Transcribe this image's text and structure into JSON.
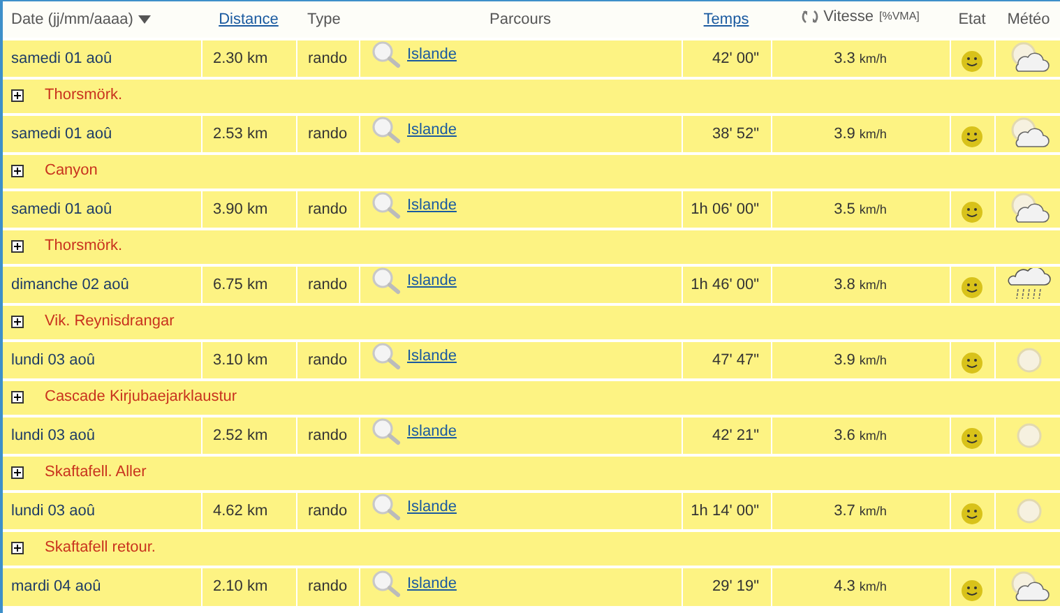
{
  "table": {
    "columns": [
      {
        "label": "Date (jj/mm/aaaa)",
        "kind": "plain",
        "sorted": true
      },
      {
        "label": "Distance",
        "kind": "link",
        "sorted": false
      },
      {
        "label": "Type",
        "kind": "plain",
        "sorted": false
      },
      {
        "label": "Parcours",
        "kind": "plain",
        "sorted": false
      },
      {
        "label": "Temps",
        "kind": "link",
        "sorted": false
      },
      {
        "label": "Vitesse",
        "note": "[%VMA]",
        "kind": "toggle",
        "sorted": false
      },
      {
        "label": "Etat",
        "kind": "plain",
        "sorted": false
      },
      {
        "label": "Météo",
        "kind": "plain",
        "sorted": false
      }
    ],
    "rows": [
      {
        "date": "samedi 01 aoû",
        "distance": "2.30 km",
        "type": "rando",
        "route": "Islande",
        "time": "42' 00\"",
        "speed": "3.3",
        "unit": "km/h",
        "etat": {
          "kind": "happy"
        },
        "meteo": {
          "kind": "sun_cloud"
        },
        "detail": "Thorsmörk.",
        "expanded": false
      },
      {
        "date": "samedi 01 aoû",
        "distance": "2.53 km",
        "type": "rando",
        "route": "Islande",
        "time": "38' 52\"",
        "speed": "3.9",
        "unit": "km/h",
        "etat": {
          "kind": "happy"
        },
        "meteo": {
          "kind": "sun_cloud"
        },
        "detail": "Canyon",
        "expanded": false
      },
      {
        "date": "samedi 01 aoû",
        "distance": "3.90 km",
        "type": "rando",
        "route": "Islande",
        "time": "1h 06' 00\"",
        "speed": "3.5",
        "unit": "km/h",
        "etat": {
          "kind": "happy"
        },
        "meteo": {
          "kind": "sun_cloud"
        },
        "detail": "Thorsmörk.",
        "expanded": false
      },
      {
        "date": "dimanche 02 aoû",
        "distance": "6.75 km",
        "type": "rando",
        "route": "Islande",
        "time": "1h 46' 00\"",
        "speed": "3.8",
        "unit": "km/h",
        "etat": {
          "kind": "happy"
        },
        "meteo": {
          "kind": "rain"
        },
        "detail": "Vik. Reynisdrangar",
        "expanded": false
      },
      {
        "date": "lundi 03 aoû",
        "distance": "3.10 km",
        "type": "rando",
        "route": "Islande",
        "time": "47' 47\"",
        "speed": "3.9",
        "unit": "km/h",
        "etat": {
          "kind": "happy"
        },
        "meteo": {
          "kind": "sun"
        },
        "detail": "Cascade Kirjubaejarklaustur",
        "expanded": false
      },
      {
        "date": "lundi 03 aoû",
        "distance": "2.52 km",
        "type": "rando",
        "route": "Islande",
        "time": "42' 21\"",
        "speed": "3.6",
        "unit": "km/h",
        "etat": {
          "kind": "happy"
        },
        "meteo": {
          "kind": "sun"
        },
        "detail": "Skaftafell. Aller",
        "expanded": false
      },
      {
        "date": "lundi 03 aoû",
        "distance": "4.62 km",
        "type": "rando",
        "route": "Islande",
        "time": "1h 14' 00\"",
        "speed": "3.7",
        "unit": "km/h",
        "etat": {
          "kind": "happy"
        },
        "meteo": {
          "kind": "sun"
        },
        "detail": "Skaftafell retour.",
        "expanded": false
      },
      {
        "date": "mardi 04 aoû",
        "distance": "2.10 km",
        "type": "rando",
        "route": "Islande",
        "time": "29' 19\"",
        "speed": "4.3",
        "unit": "km/h",
        "etat": {
          "kind": "happy"
        },
        "meteo": {
          "kind": "sun_cloud"
        }
      }
    ]
  }
}
